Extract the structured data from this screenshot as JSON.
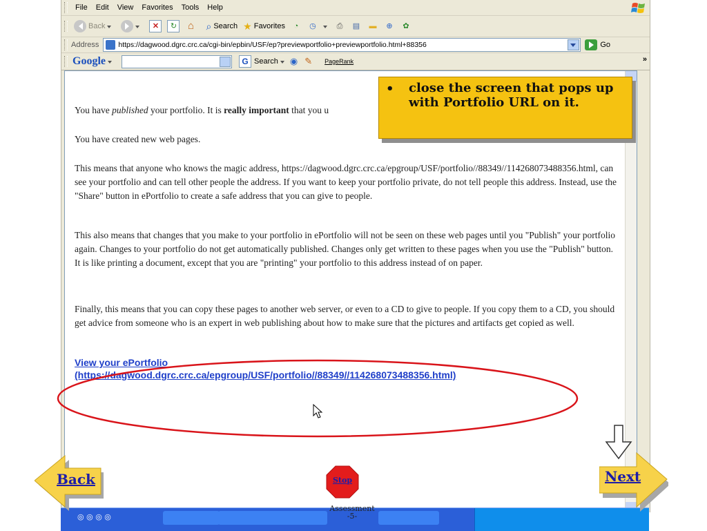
{
  "menu": [
    "File",
    "Edit",
    "View",
    "Favorites",
    "Tools",
    "Help"
  ],
  "toolbar": {
    "back": "Back",
    "search": "Search",
    "favorites": "Favorites"
  },
  "address": {
    "label": "Address",
    "url": "https://dagwood.dgrc.crc.ca/cgi-bin/epbin/USF/ep?previewportfolio+previewportfolio.html+88356",
    "go": "Go"
  },
  "googlebar": {
    "logo": "Google",
    "search_label": "Search",
    "pagerank": "PageRank"
  },
  "content": {
    "p1_a": "You have ",
    "p1_em": "published",
    "p1_b": " your portfolio. It is ",
    "p1_strong": "really important",
    "p1_c": " that you u",
    "p2": "You have created new web pages.",
    "p3": "This means that anyone who knows the magic address, https://dagwood.dgrc.crc.ca/epgroup/USF/portfolio//88349//114268073488356.html, can see your portfolio and can tell other people the address. If you want to keep your portfolio private, do not tell people this address. Instead, use the \"Share\" button in ePortfolio to create a safe address that you can give to people.",
    "p4": "This also means that changes that you make to your portfolio in ePortfolio will not be seen on these web pages until you \"Publish\" your portfolio again. Changes to your portfolio do not get automatically published. Changes only get written to these pages when you use the \"Publish\" button. It is like printing a document, except that you are \"printing\" your portfolio to this address instead of on paper.",
    "p5": "Finally, this means that you can copy these pages to another web server, or even to a CD to give to people. If you copy them to a CD, you should get advice from someone who is an expert in web publishing about how to make sure that the pictures and artifacts get copied as well.",
    "link_title": "View your ePortfolio",
    "link_url": "(https://dagwood.dgrc.crc.ca/epgroup/USF/portfolio//88349//114268073488356.html)"
  },
  "callout": {
    "bullet": "•",
    "text": "close the screen that pops up with Portfolio URL on it."
  },
  "nav": {
    "back": "Back",
    "next": "Next",
    "stop": "Stop"
  },
  "footer": {
    "title": "Assessment",
    "page": "-5-"
  },
  "colors": {
    "callout_bg": "#f5c211",
    "nav_arrow": "#f7d24a",
    "link": "#1f3fc9",
    "ellipse": "#d9141a",
    "stop": "#e31c1c"
  }
}
